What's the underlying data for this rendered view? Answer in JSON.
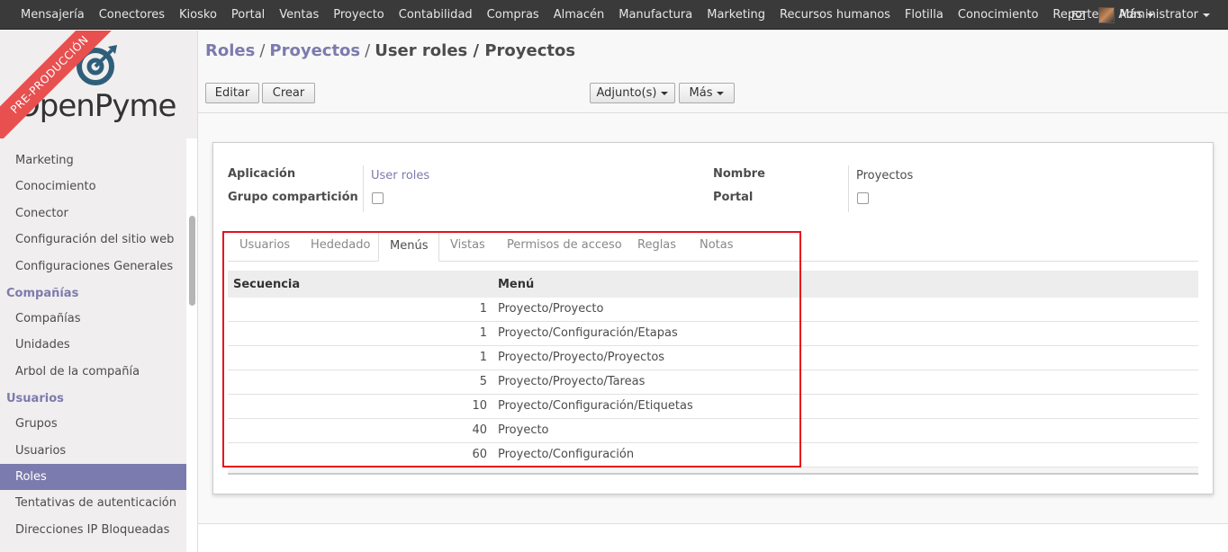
{
  "topbar": {
    "menu": [
      "Mensajería",
      "Conectores",
      "Kiosko",
      "Portal",
      "Ventas",
      "Proyecto",
      "Contabilidad",
      "Compras",
      "Almacén",
      "Manufactura",
      "Marketing",
      "Recursos humanos",
      "Flotilla",
      "Conocimiento",
      "Reportes"
    ],
    "more": "Más",
    "user": "Administrator"
  },
  "logo": {
    "ribbon": "PRE-PRODUCCIÓN",
    "brand": "OpenPyme"
  },
  "sidebar": {
    "items_top": [
      "Marketing",
      "Conocimiento",
      "Conector",
      "Configuración del sitio web",
      "Configuraciones Generales"
    ],
    "section_companies": "Compañías",
    "items_companies": [
      "Compañías",
      "Unidades",
      "Arbol de la compañía"
    ],
    "section_users": "Usuarios",
    "items_users": [
      "Grupos",
      "Usuarios",
      "Roles",
      "Tentativas de autenticación",
      "Direcciones IP Bloqueadas"
    ],
    "active": "Roles"
  },
  "breadcrumb": {
    "b1": "Roles",
    "b2": "Proyectos",
    "current": "User roles / Proyectos",
    "sep": "/"
  },
  "buttons": {
    "edit": "Editar",
    "create": "Crear",
    "attachments": "Adjunto(s)",
    "more": "Más"
  },
  "form": {
    "application_label": "Aplicación",
    "application_value": "User roles",
    "sharing_group_label": "Grupo compartición",
    "name_label": "Nombre",
    "name_value": "Proyectos",
    "portal_label": "Portal"
  },
  "tabs": [
    "Usuarios",
    "Hededado",
    "Menús",
    "Vistas",
    "Permisos de acceso",
    "Reglas",
    "Notas"
  ],
  "active_tab": "Menús",
  "menus_table": {
    "headers": {
      "sequence": "Secuencia",
      "menu": "Menú"
    },
    "rows": [
      {
        "seq": "1",
        "menu": "Proyecto/Proyecto"
      },
      {
        "seq": "1",
        "menu": "Proyecto/Configuración/Etapas"
      },
      {
        "seq": "1",
        "menu": "Proyecto/Proyecto/Proyectos"
      },
      {
        "seq": "5",
        "menu": "Proyecto/Proyecto/Tareas"
      },
      {
        "seq": "10",
        "menu": "Proyecto/Configuración/Etiquetas"
      },
      {
        "seq": "40",
        "menu": "Proyecto"
      },
      {
        "seq": "60",
        "menu": "Proyecto/Configuración"
      }
    ]
  },
  "colors": {
    "accent": "#7c7bad",
    "topbar": "#3a3a3a",
    "highlight": "#e8101c",
    "ribbon": "#e85050"
  }
}
